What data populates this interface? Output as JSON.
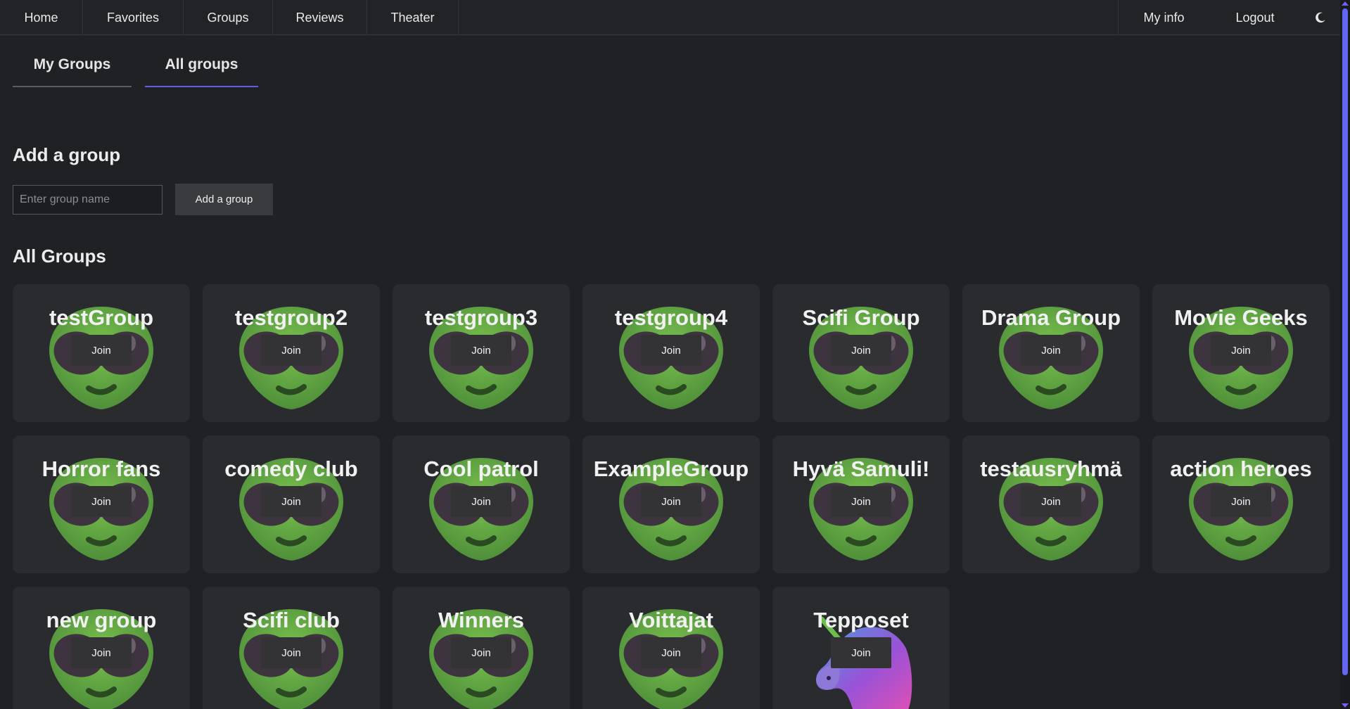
{
  "nav": {
    "left": [
      "Home",
      "Favorites",
      "Groups",
      "Reviews",
      "Theater"
    ],
    "right": [
      "My info",
      "Logout"
    ],
    "theme_icon": "moon-icon"
  },
  "tabs": [
    "My Groups",
    "All groups"
  ],
  "active_tab": "All groups",
  "add_group": {
    "heading": "Add a group",
    "placeholder": "Enter group name",
    "button": "Add a group"
  },
  "all_groups_heading": "All Groups",
  "join_label": "Join",
  "groups": [
    {
      "name": "testGroup",
      "avatar": "alien-icon"
    },
    {
      "name": "testgroup2",
      "avatar": "alien-icon"
    },
    {
      "name": "testgroup3",
      "avatar": "alien-icon"
    },
    {
      "name": "testgroup4",
      "avatar": "alien-icon"
    },
    {
      "name": "Scifi Group",
      "avatar": "alien-icon"
    },
    {
      "name": "Drama Group",
      "avatar": "alien-icon"
    },
    {
      "name": "Movie Geeks",
      "avatar": "alien-icon"
    },
    {
      "name": "Horror fans",
      "avatar": "alien-icon"
    },
    {
      "name": "comedy club",
      "avatar": "alien-icon"
    },
    {
      "name": "Cool patrol",
      "avatar": "alien-icon"
    },
    {
      "name": "ExampleGroup",
      "avatar": "alien-icon"
    },
    {
      "name": "Hyvä Samuli!",
      "avatar": "alien-icon"
    },
    {
      "name": "testausryhmä",
      "avatar": "alien-icon"
    },
    {
      "name": "action heroes",
      "avatar": "alien-icon"
    },
    {
      "name": "new group",
      "avatar": "alien-icon"
    },
    {
      "name": "Scifi club",
      "avatar": "alien-icon"
    },
    {
      "name": "Winners",
      "avatar": "alien-icon"
    },
    {
      "name": "Voittajat",
      "avatar": "alien-icon"
    },
    {
      "name": "Tepposet",
      "avatar": "unicorn-icon"
    }
  ],
  "colors": {
    "background": "#202124",
    "card": "#2a2b2e",
    "accent": "#5f5fe6",
    "alien_green": "#63a845"
  }
}
